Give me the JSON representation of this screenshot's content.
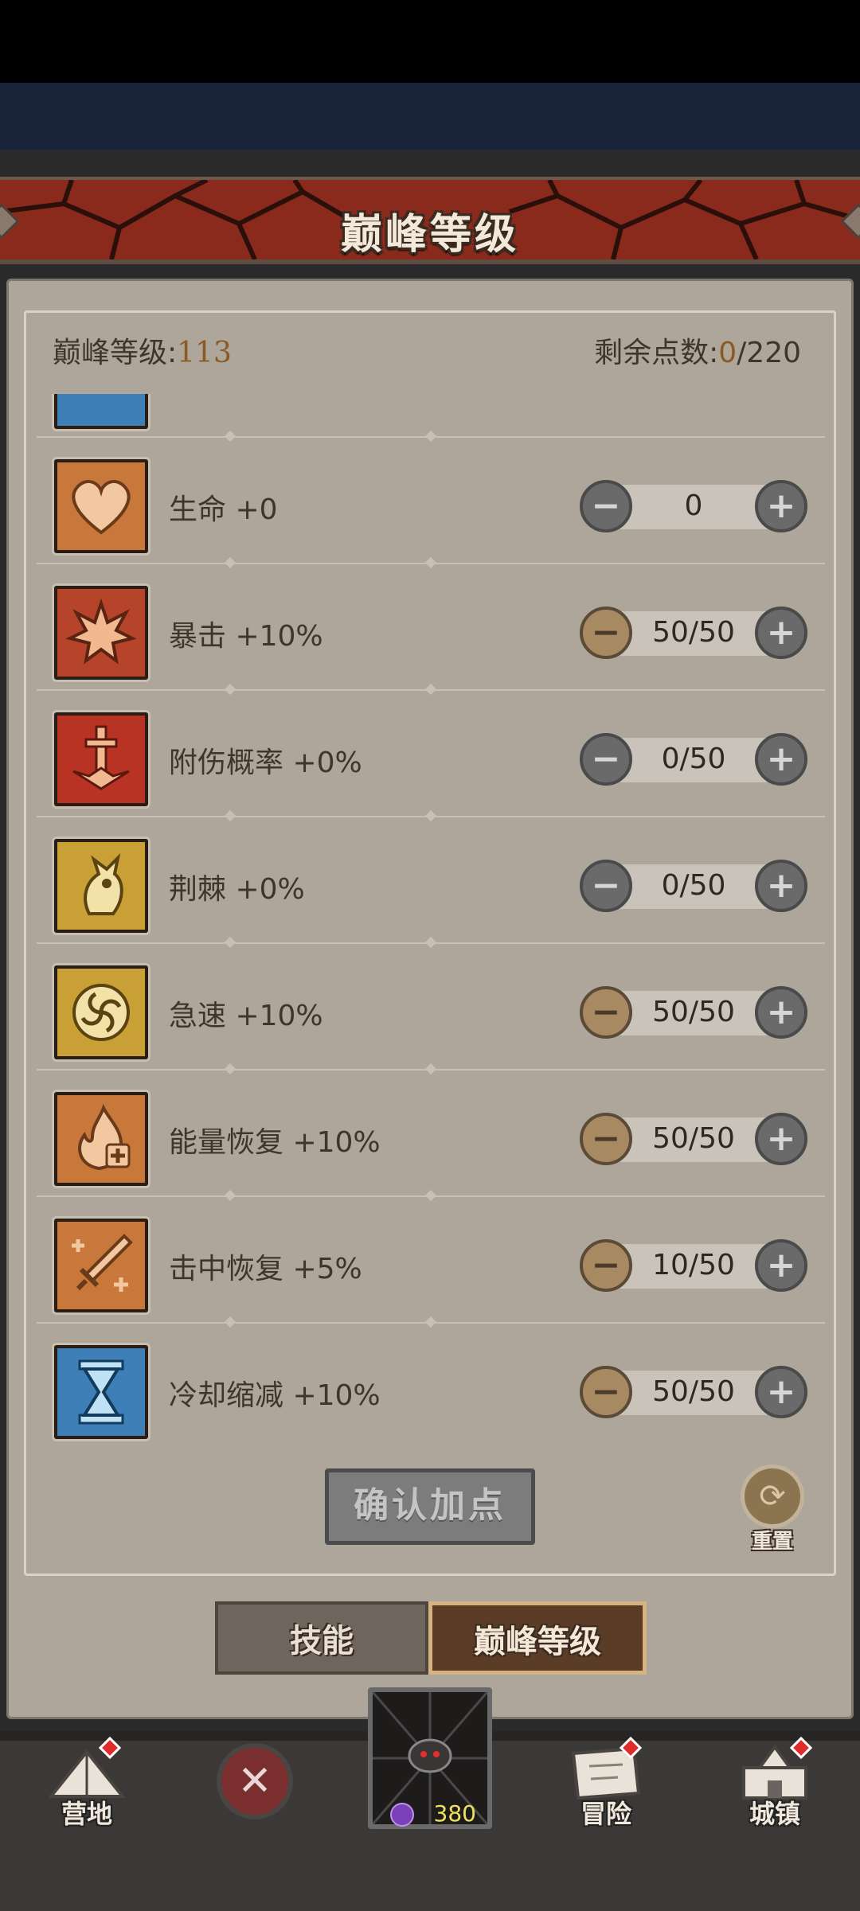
{
  "title": "巅峰等级",
  "header": {
    "level_label": "巅峰等级:",
    "level_value": "113",
    "points_label": "剩余点数:",
    "points_used": "0",
    "points_total": "/220"
  },
  "stats": [
    {
      "label": "生命 +0",
      "value": "0",
      "icon": "heart-icon",
      "tile": "#c8783a",
      "minus_active": false
    },
    {
      "label": "暴击 +10%",
      "value": "50/50",
      "icon": "critical-burst-icon",
      "tile": "#b5442a",
      "minus_active": true
    },
    {
      "label": "附伤概率 +0%",
      "value": "0/50",
      "icon": "sword-strike-icon",
      "tile": "#b83324",
      "minus_active": false
    },
    {
      "label": "荆棘 +0%",
      "value": "0/50",
      "icon": "thorns-icon",
      "tile": "#c8a036",
      "minus_active": false
    },
    {
      "label": "急速 +10%",
      "value": "50/50",
      "icon": "swirl-icon",
      "tile": "#c8a036",
      "minus_active": true
    },
    {
      "label": "能量恢复 +10%",
      "value": "50/50",
      "icon": "flame-plus-icon",
      "tile": "#c8783a",
      "minus_active": true
    },
    {
      "label": "击中恢复 +5%",
      "value": "10/50",
      "icon": "sword-plus-icon",
      "tile": "#c8783a",
      "minus_active": true
    },
    {
      "label": "冷却缩减 +10%",
      "value": "50/50",
      "icon": "hourglass-icon",
      "tile": "#3f7fb8",
      "minus_active": true
    }
  ],
  "actions": {
    "confirm_label": "确认加点",
    "reset_label": "重置"
  },
  "tabs": [
    {
      "label": "技能",
      "active": false
    },
    {
      "label": "巅峰等级",
      "active": true
    }
  ],
  "bottom_nav": {
    "camp": "营地",
    "adventure": "冒险",
    "town": "城镇",
    "energy": "380"
  }
}
